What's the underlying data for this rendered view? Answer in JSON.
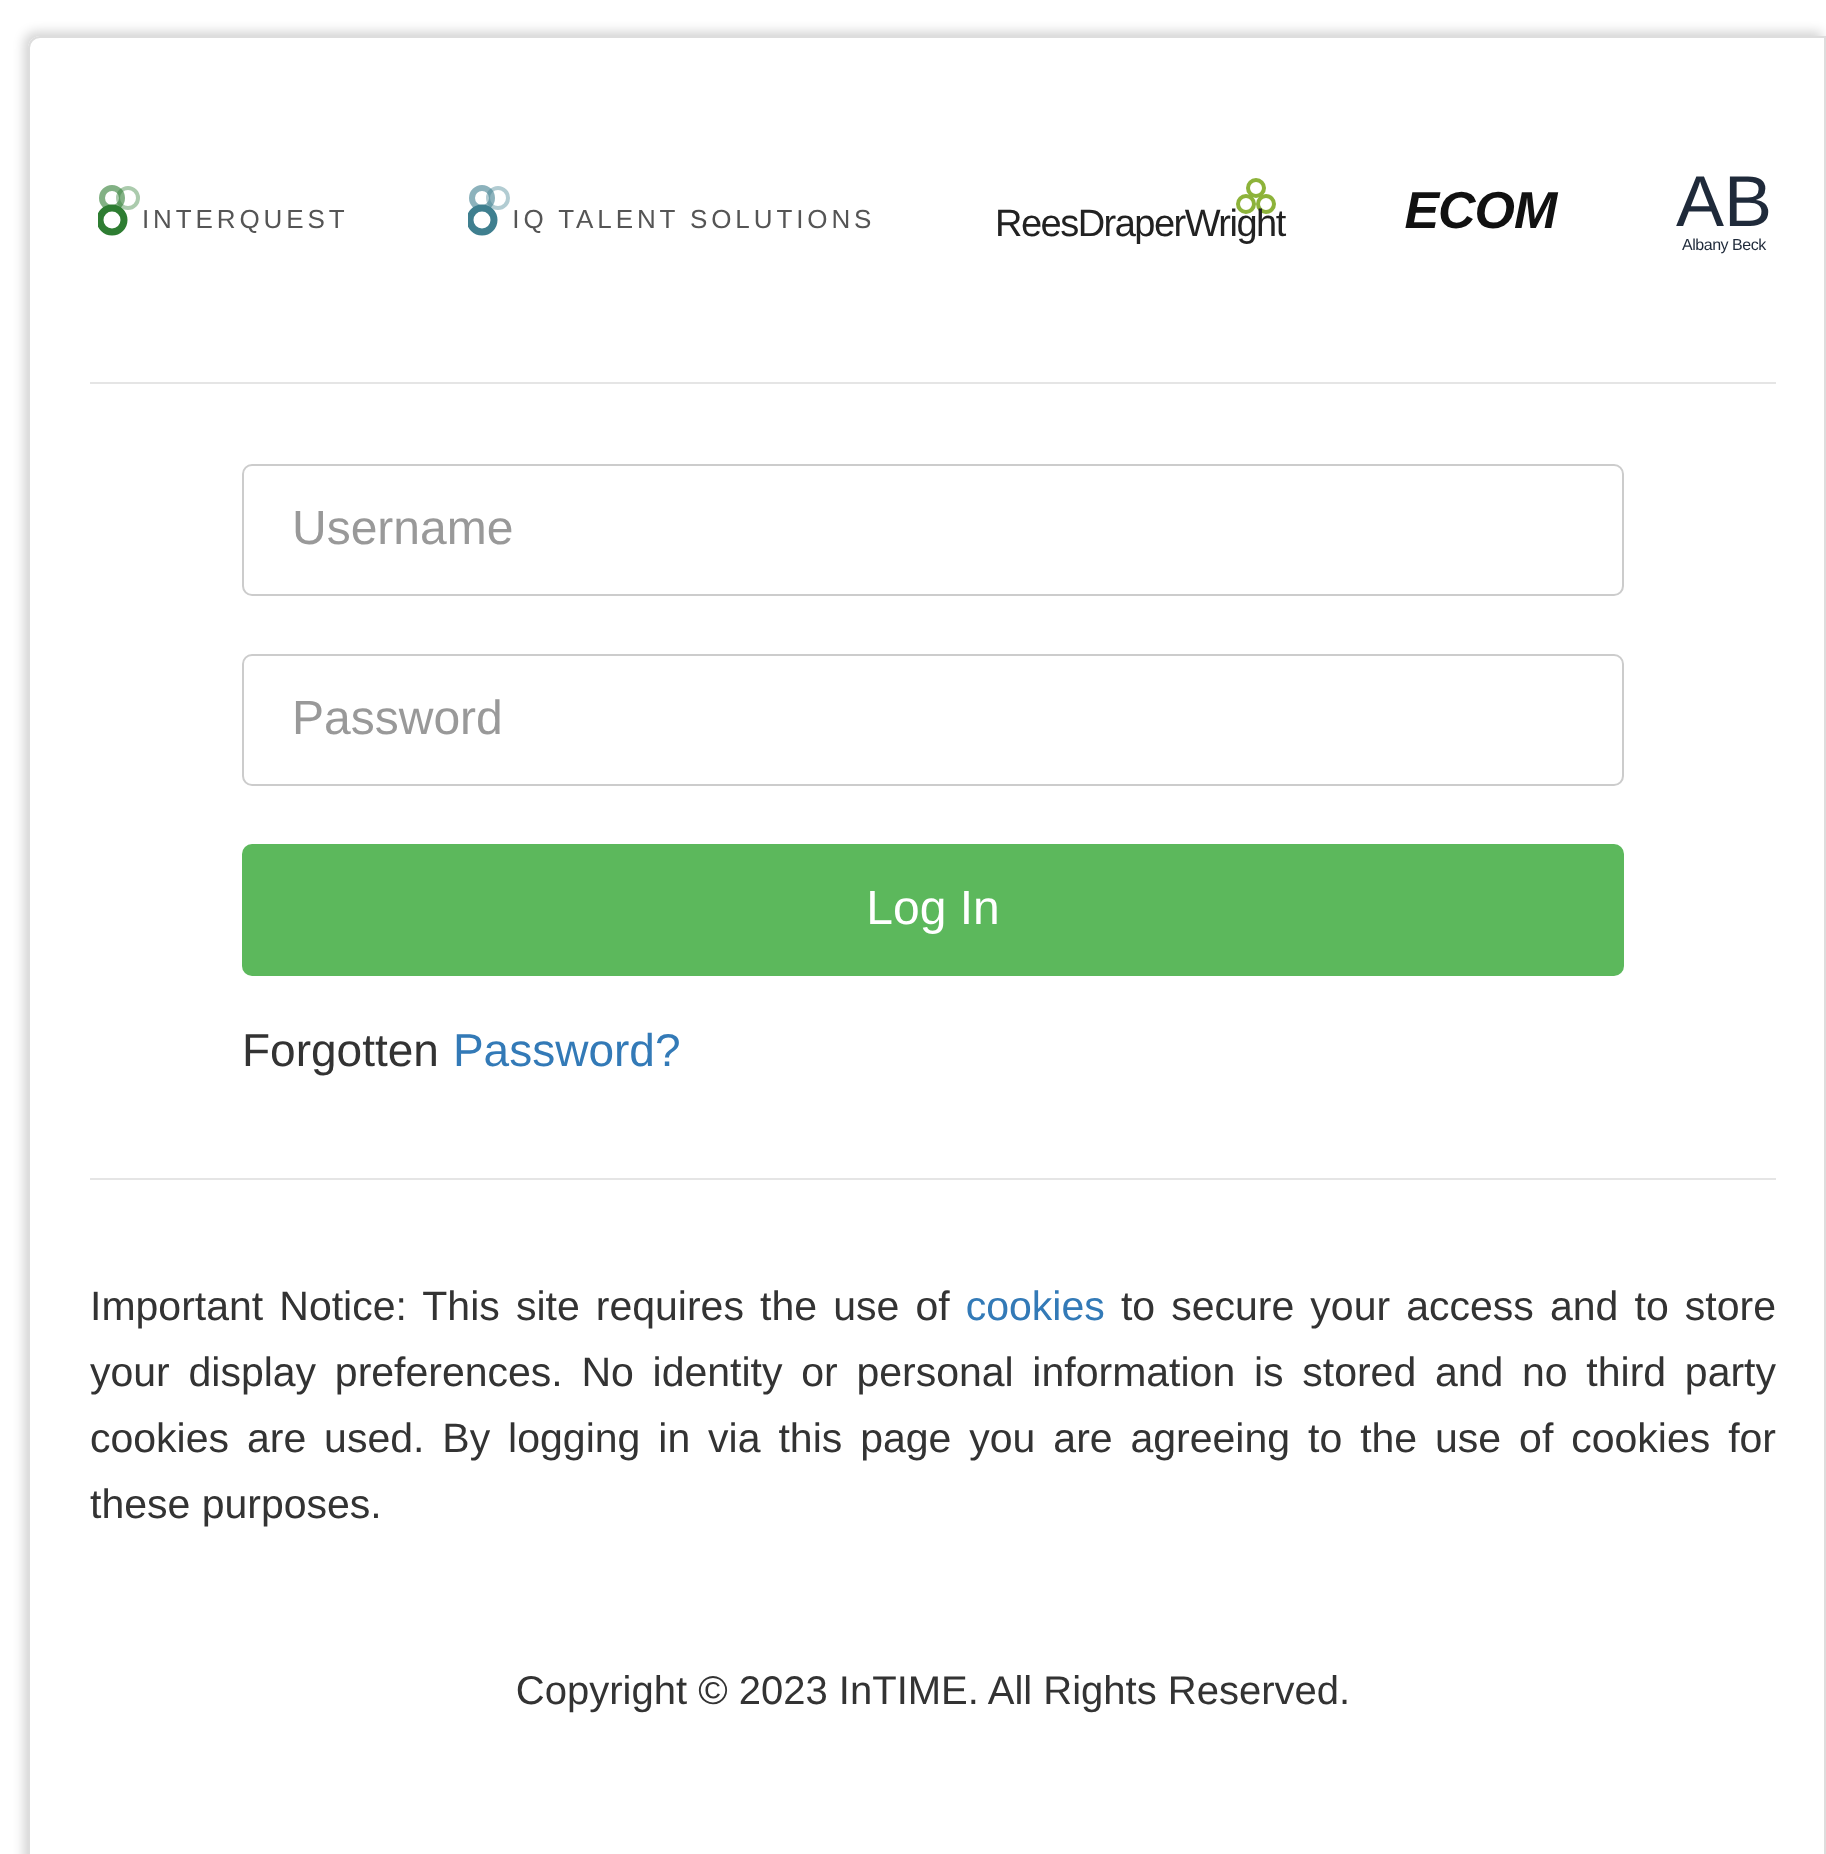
{
  "logos": [
    {
      "kind": "rings",
      "text": "INTERQUEST"
    },
    {
      "kind": "rings",
      "text": "IQ TALENT SOLUTIONS"
    },
    {
      "kind": "trefoil",
      "text": "ReesDraperWright"
    },
    {
      "kind": "block",
      "text": "ECOM"
    },
    {
      "kind": "stack",
      "text": "AB",
      "subtitle": "Albany Beck"
    }
  ],
  "form": {
    "username": {
      "placeholder": "Username"
    },
    "password": {
      "placeholder": "Password"
    },
    "login_button": "Log In",
    "forgot_text": "Forgotten",
    "forgot_link": "Password?"
  },
  "notice": {
    "before": "Important Notice: This site requires the use of",
    "link": "cookies",
    "after": "to secure your access and to store your display preferences. No identity or personal information is stored and no third party cookies are used. By logging in via this page you are agreeing to the use of cookies for these purposes."
  },
  "copyright": "Copyright © 2023 InTIME. All Rights Reserved."
}
